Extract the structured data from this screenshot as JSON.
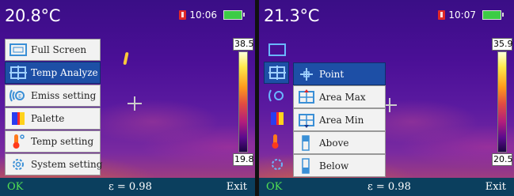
{
  "left": {
    "temperature": "20.8°C",
    "time": "10:06",
    "scale": {
      "max": "38.5",
      "min": "19.8"
    },
    "menu": [
      {
        "label": "Full Screen",
        "icon": "fullscreen-icon"
      },
      {
        "label": "Temp Analyze",
        "icon": "crosshair-box-icon",
        "selected": true
      },
      {
        "label": "Emiss setting",
        "icon": "emissivity-icon"
      },
      {
        "label": "Palette",
        "icon": "palette-icon"
      },
      {
        "label": "Temp setting",
        "icon": "thermometer-icon"
      },
      {
        "label": "System setting",
        "icon": "gear-icon"
      }
    ],
    "bottom": {
      "ok": "OK",
      "emissivity": "ε = 0.98",
      "exit": "Exit"
    }
  },
  "right": {
    "temperature": "21.3°C",
    "time": "10:07",
    "scale": {
      "max": "35.9",
      "min": "20.5"
    },
    "submenu": [
      {
        "label": "Point",
        "icon": "point-crosshair-icon",
        "selected": true
      },
      {
        "label": "Area Max",
        "icon": "area-max-icon"
      },
      {
        "label": "Area Min",
        "icon": "area-min-icon"
      },
      {
        "label": "Above",
        "icon": "above-icon"
      },
      {
        "label": "Below",
        "icon": "below-icon"
      }
    ],
    "bottom": {
      "ok": "OK",
      "emissivity": "ε = 0.98",
      "exit": "Exit"
    }
  },
  "colors": {
    "menu_selected": "#1d4fa6",
    "bottom_bar": "#0b3f5e",
    "ok_text": "#52e052",
    "battery": "#3ccc45",
    "sd_card": "#e02828"
  }
}
